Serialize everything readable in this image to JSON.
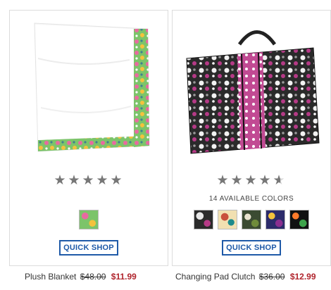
{
  "products": [
    {
      "name": "Plush Blanket",
      "old_price": "$48.00",
      "sale_price": "$11.99",
      "quick_shop_label": "QUICK SHOP",
      "rating": 5,
      "colors_label": ""
    },
    {
      "name": "Changing Pad Clutch",
      "old_price": "$36.00",
      "sale_price": "$12.99",
      "quick_shop_label": "QUICK SHOP",
      "rating": 4.5,
      "colors_label": "14 AVAILABLE COLORS"
    }
  ],
  "colors": {
    "accent": "#1f5aa8",
    "sale": "#b0252d",
    "star": "#777777"
  }
}
